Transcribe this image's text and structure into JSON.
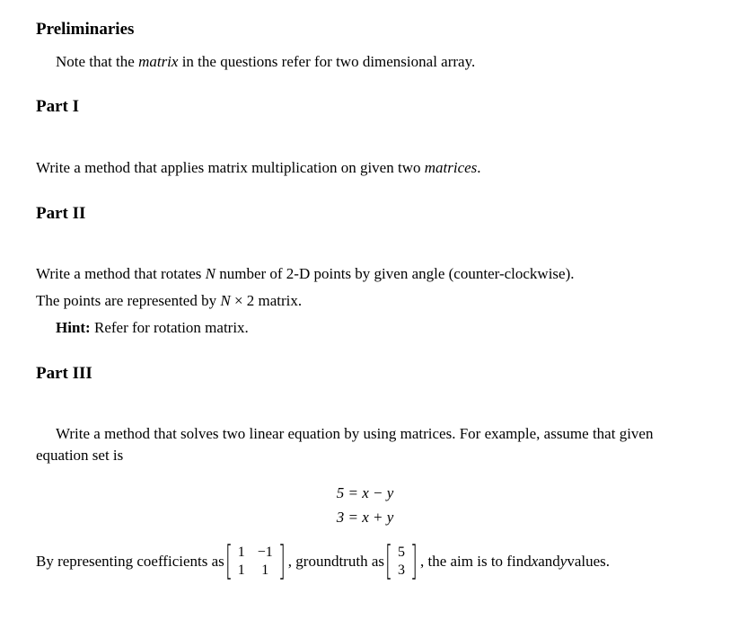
{
  "sections": {
    "preliminaries": {
      "heading": "Preliminaries",
      "note_a": "Note that the ",
      "note_em": "matrix",
      "note_b": " in the questions refer for two dimensional array."
    },
    "part1": {
      "heading": "Part I",
      "text_a": "Write a method that applies matrix multiplication on given two ",
      "text_em": "matrices",
      "text_b": "."
    },
    "part2": {
      "heading": "Part II",
      "line1_a": "Write a method that rotates ",
      "line1_N": "N",
      "line1_b": " number of 2-D points by given angle (counter-clockwise).",
      "line2_a": "The points are represented by ",
      "line2_N": "N",
      "line2_mid": " × 2 matrix.",
      "hint_label": "Hint:",
      "hint_text": " Refer for rotation matrix."
    },
    "part3": {
      "heading": "Part III",
      "intro": "Write a method that solves two linear equation by using matrices. For example, assume that given equation set is",
      "eq1": "5 = x − y",
      "eq2": "3 = x + y",
      "line_a": "By representing coefficients as ",
      "coef_matrix": {
        "r1c1": "1",
        "r1c2": "−1",
        "r2c1": "1",
        "r2c2": "1"
      },
      "line_b": ", groundtruth as ",
      "gt_matrix": {
        "r1": "5",
        "r2": "3"
      },
      "line_c": ", the aim is to find ",
      "x": "x",
      "line_and": " and ",
      "y": "y",
      "line_end": " values."
    }
  }
}
